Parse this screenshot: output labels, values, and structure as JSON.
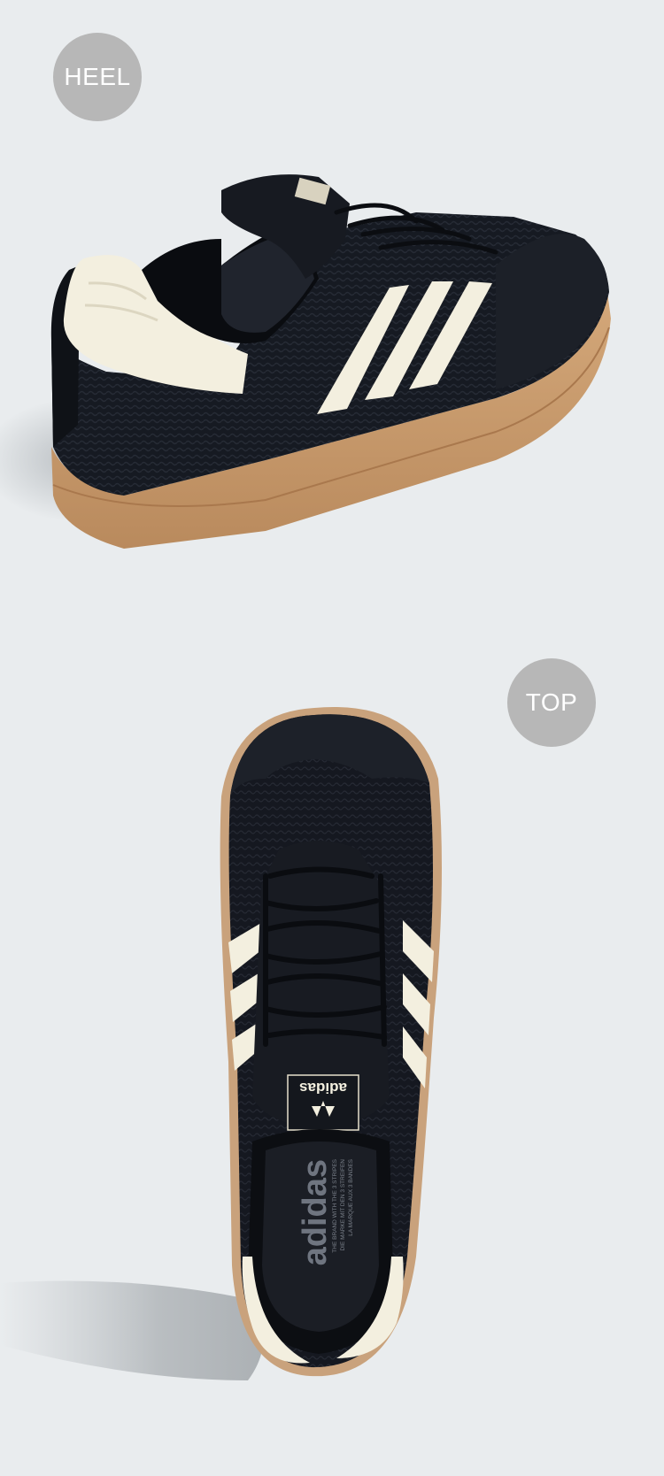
{
  "views": [
    {
      "label": "HEEL"
    },
    {
      "label": "TOP"
    }
  ],
  "shoe": {
    "upper_color": "#15181f",
    "stripe_color": "#f3efdf",
    "sole_color": "#c79b6f",
    "tongue_brand": "adidas",
    "insole_brand": "adidas",
    "insole_tagline_1": "THE BRAND WITH THE 3 STRIPES",
    "insole_tagline_2": "DIE MARKE MIT DEN 3 STREIFEN",
    "insole_tagline_3": "LA MARQUE AUX 3 BANDES"
  },
  "colors": {
    "background": "#e9ecee",
    "badge": "#b7b7b7",
    "badge_text": "#ffffff"
  }
}
